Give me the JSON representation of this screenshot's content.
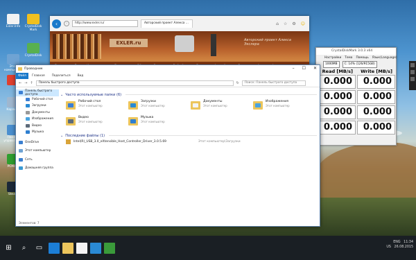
{
  "desktop": {
    "icons": [
      {
        "label": "Exler.Info",
        "color": "#f2f2f2"
      },
      {
        "label": "CrystalDisk Mark",
        "color": "#f0c020"
      },
      {
        "label": "Этот компьютер",
        "color": "#6fa3d3"
      },
      {
        "label": "CrystalDisk",
        "color": "#58b050"
      },
      {
        "label": "",
        "color": "#e04030"
      },
      {
        "label": "Корзина",
        "color": "#9fb7cf"
      },
      {
        "label": "Панель управления",
        "color": "#4a8fcf"
      },
      {
        "label": "PCMark",
        "color": "#2f9e2f"
      },
      {
        "label": "Steam",
        "color": "#1b2838"
      }
    ]
  },
  "browser": {
    "address": "http://www.exler.ru/",
    "tab_title": "Авторский проект Алекса ...",
    "site_logo": "EXLER.ru",
    "site_tagline": "Авторский проект Алекса Экслера",
    "nav": [
      "Главная",
      "Блог",
      "Кинорецензии",
      "Биннопары",
      "Обзоры",
      "Рассказы",
      "Веб-обзоры",
      "Лингвео",
      "Фотообзоры",
      "Гороскоп",
      "Архив",
      "Форум"
    ]
  },
  "benchmark": {
    "title": "CrystalDiskMark 3.0.3 x64",
    "menu": [
      "Настройки",
      "Тема",
      "Помощь",
      "Язык(Language)"
    ],
    "size_select": "1000MB",
    "drive_select": "C: 14% (126/915GB)",
    "header_read": "Read [MB/s]",
    "header_write": "Write [MB/s]",
    "rows": [
      {
        "read": "0.000",
        "write": "0.000"
      },
      {
        "read": "0.000",
        "write": "0.000"
      },
      {
        "read": "0.000",
        "write": "0.000"
      },
      {
        "read": "0.000",
        "write": "0.000"
      }
    ]
  },
  "explorer": {
    "title": "Проводник",
    "ribbon": {
      "file": "Файл",
      "tabs": [
        "Главная",
        "Поделиться",
        "Вид"
      ]
    },
    "path": "Панель быстрого доступа",
    "search_placeholder": "Поиск: Панель быстрого доступа",
    "nav": [
      "Панель быстрого доступа",
      "Рабочий стол",
      "Загрузки",
      "Документы",
      "Изображения",
      "Видео",
      "Музыка",
      "OneDrive",
      "Этот компьютер",
      "Сеть",
      "Домашняя группа"
    ],
    "frequent_header": "Часто используемые папки (6)",
    "folders": [
      {
        "name": "Рабочий стол",
        "sub": "Этот компьютер",
        "accent": "#3b7fd4"
      },
      {
        "name": "Загрузки",
        "sub": "Этот компьютер",
        "accent": "#2a8ad4"
      },
      {
        "name": "Документы",
        "sub": "Этот компьютер",
        "accent": "#f4f4f4"
      },
      {
        "name": "Изображения",
        "sub": "Этот компьютер",
        "accent": "#4aa3df"
      },
      {
        "name": "Видео",
        "sub": "Этот компьютер",
        "accent": "#5d6b7a"
      },
      {
        "name": "Музыка",
        "sub": "Этот компьютер",
        "accent": "#2f7fd0"
      }
    ],
    "recent_header": "Последние файлы (1)",
    "recent": [
      {
        "name": "Intel(R)_USB_3.0_eXtensible_Host_Controller_Driver_3.0.5.69",
        "location": "Этот компьютер\\Загрузки"
      }
    ],
    "status": "Элементов: 7"
  },
  "tray": {
    "language": "ENG",
    "region": "US",
    "time": "11:34",
    "date": "26.08.2015"
  }
}
